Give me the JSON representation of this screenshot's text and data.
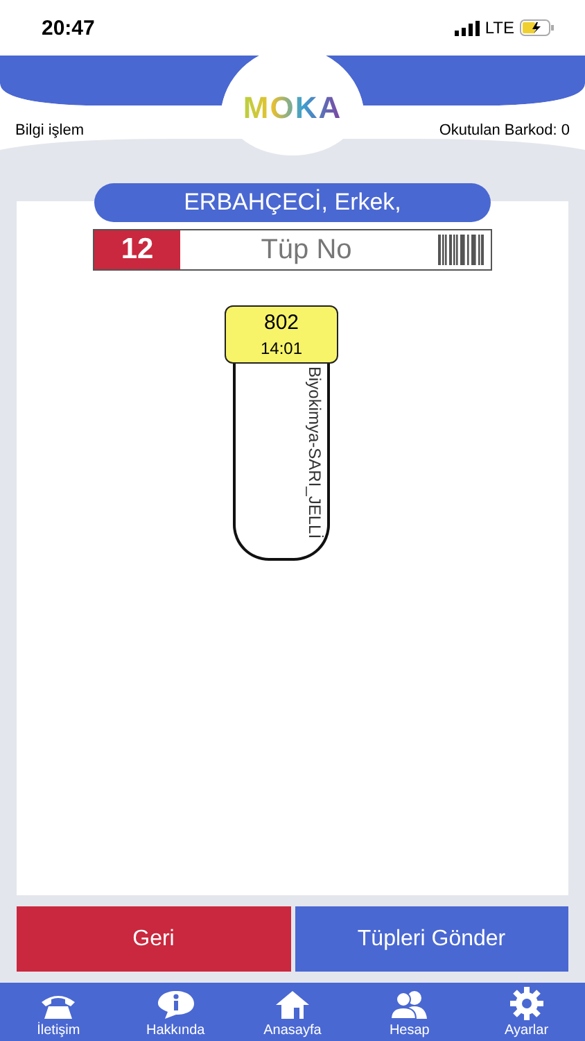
{
  "status_bar": {
    "time": "20:47",
    "network": "LTE"
  },
  "header": {
    "logo": "MOKA",
    "left": "Bilgi işlem",
    "right": "Okutulan Barkod: 0"
  },
  "patient": {
    "name": "ERBAHÇECİ, Erkek,"
  },
  "tube_field": {
    "count": "12",
    "placeholder": "Tüp No"
  },
  "tubes": [
    {
      "number": "802",
      "time": "14:01",
      "test": "Biyokimya-SARI_JELLİ",
      "color": "#f8f46a"
    }
  ],
  "buttons": [
    {
      "label": "Geri",
      "kind": "back"
    },
    {
      "label": "Tüpleri Gönder",
      "kind": "send"
    }
  ],
  "tabs": [
    {
      "label": "İletişim",
      "kind": "phone",
      "selected": false
    },
    {
      "label": "Hakkında",
      "kind": "info",
      "selected": false
    },
    {
      "label": "Anasayfa",
      "kind": "home",
      "selected": false
    },
    {
      "label": "Hesap",
      "kind": "people",
      "selected": false
    },
    {
      "label": "Ayarlar",
      "kind": "gear",
      "selected": false
    }
  ]
}
